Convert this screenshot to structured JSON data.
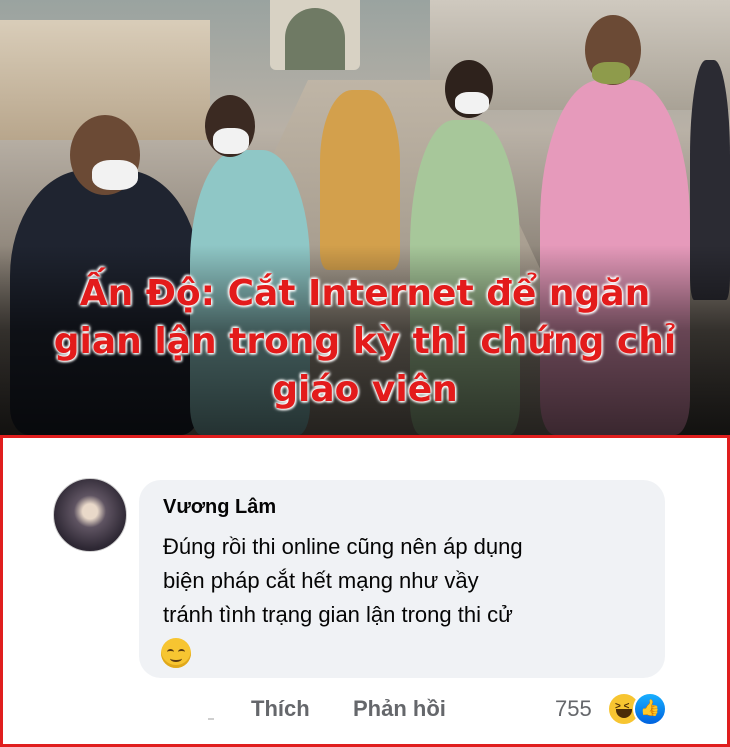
{
  "headline": {
    "line1": "Ấn Độ: Cắt Internet để ngăn",
    "line2": "gian lận trong kỳ thi chứng chỉ",
    "line3": "giáo viên"
  },
  "comment": {
    "author": "Vương Lâm",
    "text_lines": [
      "Đúng rồi thi online cũng nên áp dụng",
      "biện pháp cắt hết mạng như vầy",
      "tránh tình trạng gian lận trong thi cử"
    ],
    "emoji": "relieved-face-emoji"
  },
  "actions": {
    "like_label": "Thích",
    "reply_label": "Phản hồi"
  },
  "reactions": {
    "count": "755",
    "icons": [
      "haha-reaction-icon",
      "like-reaction-icon"
    ]
  },
  "colors": {
    "headline": "#e31b1b",
    "frame_border": "#e01e1e",
    "bubble_bg": "#f0f2f5",
    "action_text": "#65676b"
  }
}
